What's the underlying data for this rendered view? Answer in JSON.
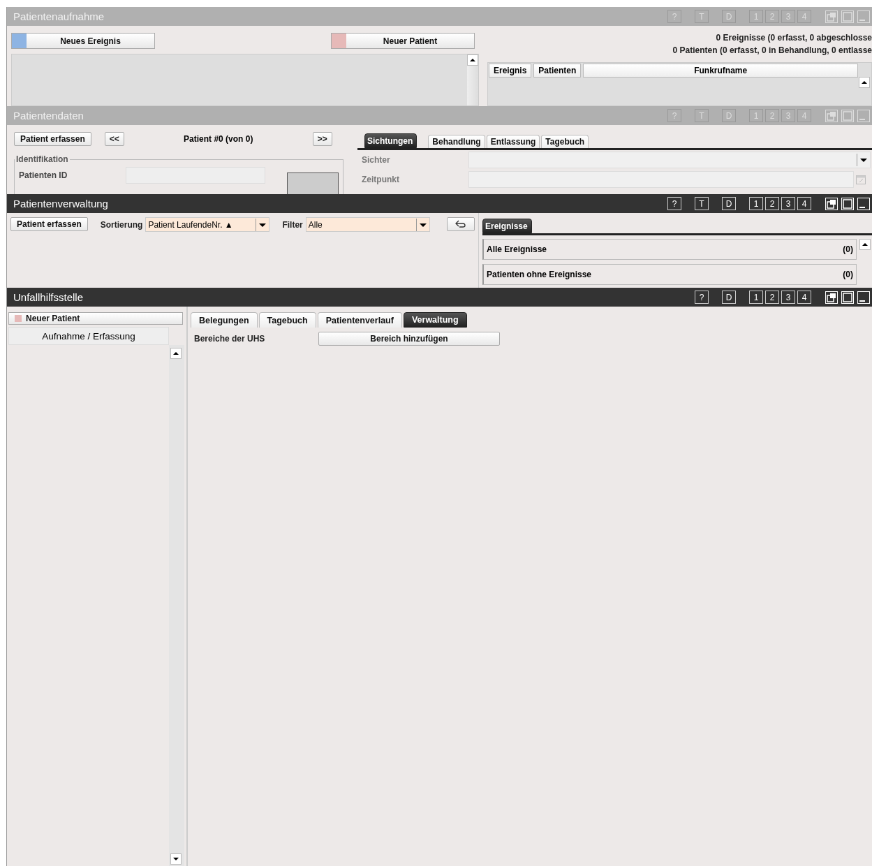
{
  "frames": [
    {
      "kind": "aufnahme",
      "title": "Patientenaufnahme",
      "active": false,
      "controls": [
        "?",
        "T",
        "D",
        "1",
        "2",
        "3",
        "4"
      ],
      "buttons": [
        {
          "label": "Neues Ereignis",
          "color": "#8eb4e3"
        },
        {
          "label": "Neuer Patient",
          "color": "#e6b9b8"
        }
      ],
      "summary": [
        "0 Ereignisse (0 erfasst, 0 abgeschlosse",
        "0 Patienten (0 erfasst, 0 in Behandlung, 0 entlasse"
      ],
      "table": {
        "columns": [
          "Ereignis",
          "Patienten",
          "Funkrufname"
        ]
      }
    },
    {
      "kind": "daten",
      "title": "Patientendaten",
      "active": false,
      "controls": [
        "?",
        "T",
        "D",
        "1",
        "2",
        "3",
        "4"
      ],
      "capture_button": "Patient erfassen",
      "prev": "<<",
      "position": "Patient #0 (von 0)",
      "next": ">>",
      "group": {
        "legend": "Identifikation",
        "fields": [
          {
            "label": "Patienten ID"
          }
        ]
      },
      "tabs": [
        {
          "label": "Sichtungen",
          "selected": true
        },
        {
          "label": "Behandlung",
          "selected": false
        },
        {
          "label": "Entlassung",
          "selected": false
        },
        {
          "label": "Tagebuch",
          "selected": false
        }
      ],
      "form": [
        {
          "label": "Sichter",
          "kind": "dropdown"
        },
        {
          "label": "Zeitpunkt",
          "kind": "date"
        }
      ]
    },
    {
      "kind": "verwaltung",
      "title": "Patientenverwaltung",
      "active": true,
      "controls": [
        "?",
        "T",
        "D",
        "1",
        "2",
        "3",
        "4"
      ],
      "capture_button": "Patient erfassen",
      "sort": {
        "label": "Sortierung",
        "value": "Patient LaufendeNr. ▲"
      },
      "filter": {
        "label": "Filter",
        "value": "Alle"
      },
      "tabs": [
        {
          "label": "Ereignisse",
          "selected": true
        }
      ],
      "list": [
        {
          "label": "Alle Ereignisse",
          "count": "(0)"
        },
        {
          "label": "Patienten ohne Ereignisse",
          "count": "(0)"
        }
      ]
    },
    {
      "kind": "uhs",
      "title": "Unfallhilfsstelle",
      "active": true,
      "controls": [
        "?",
        "D",
        "1",
        "2",
        "3",
        "4"
      ],
      "new_button": {
        "label": "Neuer Patient",
        "color": "#e6b9b8"
      },
      "side_header": "Aufnahme / Erfassung",
      "tabs": [
        {
          "label": "Belegungen",
          "selected": false
        },
        {
          "label": "Tagebuch",
          "selected": false
        },
        {
          "label": "Patientenverlauf",
          "selected": false
        },
        {
          "label": "Verwaltung",
          "selected": true
        }
      ],
      "section_label": "Bereiche der UHS",
      "add_button": "Bereich hinzufügen"
    }
  ]
}
